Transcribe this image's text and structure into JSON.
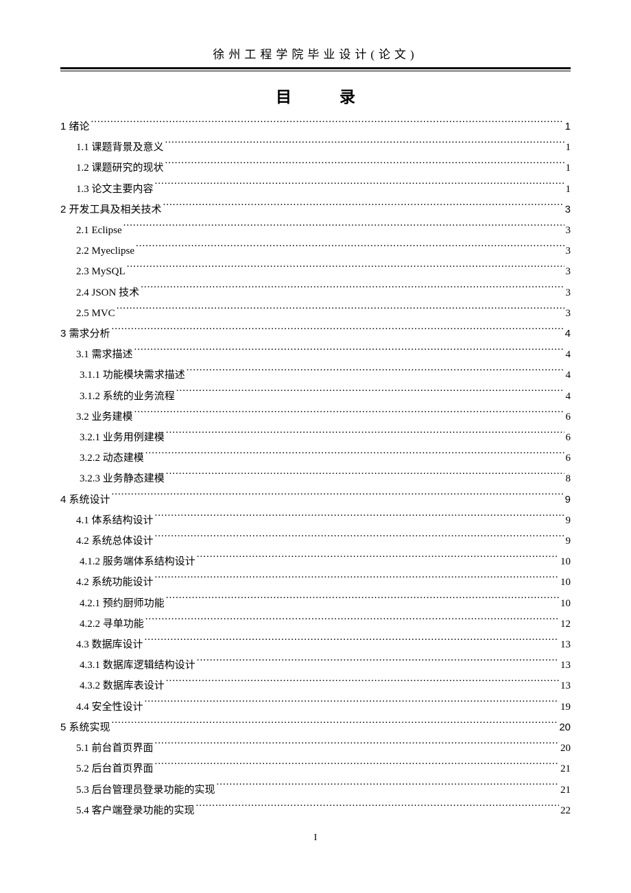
{
  "header": {
    "institution": "徐州工程学院毕业设计(论文)"
  },
  "toc": {
    "title_char1": "目",
    "title_char2": "录",
    "entries": [
      {
        "level": 0,
        "label": "1 绪论",
        "page": "1"
      },
      {
        "level": 1,
        "label": "1.1 课题背景及意义",
        "page": "1"
      },
      {
        "level": 1,
        "label": "1.2 课题研究的现状",
        "page": "1"
      },
      {
        "level": 1,
        "label": "1.3 论文主要内容",
        "page": "1"
      },
      {
        "level": 0,
        "label": "2 开发工具及相关技术",
        "page": "3"
      },
      {
        "level": 1,
        "label": "2.1 Eclipse",
        "page": "3"
      },
      {
        "level": 1,
        "label": "2.2 Myeclipse",
        "page": "3"
      },
      {
        "level": 1,
        "label": "2.3 MySQL",
        "page": "3"
      },
      {
        "level": 1,
        "label": "2.4 JSON 技术",
        "page": "3"
      },
      {
        "level": 1,
        "label": "2.5 MVC",
        "page": "3"
      },
      {
        "level": 0,
        "label": "3 需求分析",
        "page": "4"
      },
      {
        "level": 1,
        "label": "3.1 需求描述",
        "page": "4"
      },
      {
        "level": 2,
        "label": "3.1.1 功能模块需求描述",
        "page": "4"
      },
      {
        "level": 2,
        "label": "3.1.2 系统的业务流程",
        "page": "4"
      },
      {
        "level": 1,
        "label": "3.2 业务建模",
        "page": "6"
      },
      {
        "level": 2,
        "label": "3.2.1 业务用例建模",
        "page": "6"
      },
      {
        "level": 2,
        "label": "3.2.2 动态建模",
        "page": "6"
      },
      {
        "level": 2,
        "label": "3.2.3 业务静态建模",
        "page": "8"
      },
      {
        "level": 0,
        "label": "4 系统设计",
        "page": "9"
      },
      {
        "level": 1,
        "label": "4.1 体系结构设计",
        "page": "9"
      },
      {
        "level": 1,
        "label": "4.2  系统总体设计",
        "page": "9"
      },
      {
        "level": 2,
        "label": "4.1.2 服务端体系结构设计",
        "page": "10"
      },
      {
        "level": 1,
        "label": "4.2 系统功能设计",
        "page": "10"
      },
      {
        "level": 2,
        "label": "4.2.1 预约厨师功能",
        "page": "10"
      },
      {
        "level": 2,
        "label": "4.2.2 寻单功能",
        "page": "12"
      },
      {
        "level": 1,
        "label": "4.3 数据库设计",
        "page": "13"
      },
      {
        "level": 2,
        "label": "4.3.1 数据库逻辑结构设计",
        "page": "13"
      },
      {
        "level": 2,
        "label": "4.3.2 数据库表设计",
        "page": "13"
      },
      {
        "level": 1,
        "label": "4.4 安全性设计",
        "page": "19"
      },
      {
        "level": 0,
        "label": "5 系统实现",
        "page": "20"
      },
      {
        "level": 1,
        "label": "5.1 前台首页界面",
        "page": "20"
      },
      {
        "level": 1,
        "label": "5.2 后台首页界面",
        "page": "21"
      },
      {
        "level": 1,
        "label": "5.3 后台管理员登录功能的实现",
        "page": "21"
      },
      {
        "level": 1,
        "label": "5.4 客户端登录功能的实现",
        "page": "22"
      }
    ]
  },
  "footer": {
    "page_number": "I"
  }
}
